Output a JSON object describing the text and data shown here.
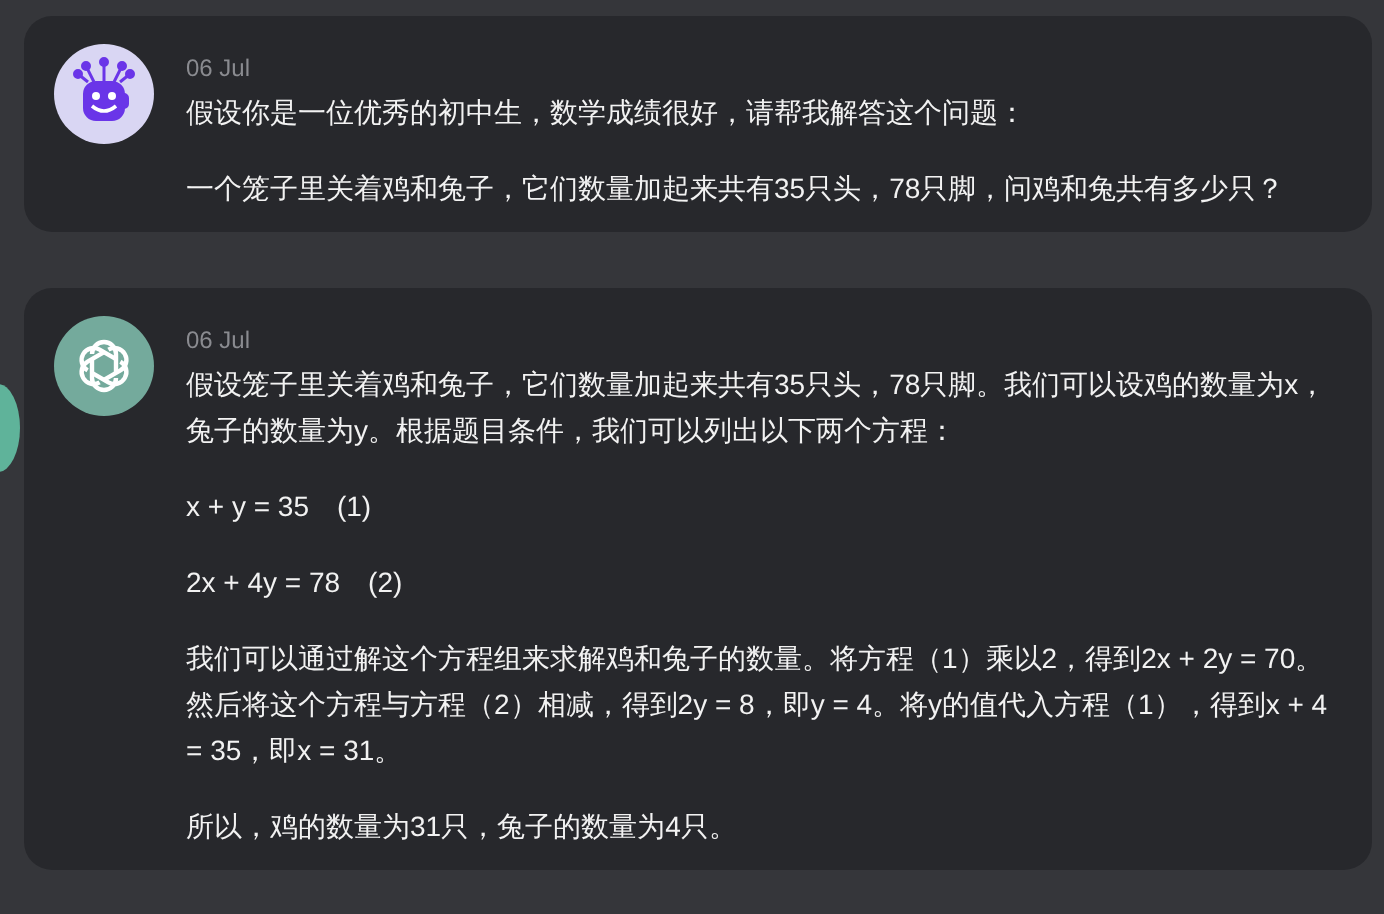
{
  "messages": [
    {
      "kind": "user",
      "date": "06 Jul",
      "paragraphs": [
        "假设你是一位优秀的初中生，数学成绩很好，请帮我解答这个问题：",
        "一个笼子里关着鸡和兔子，它们数量加起来共有35只头，78只脚，问鸡和兔共有多少只？"
      ]
    },
    {
      "kind": "assistant",
      "date": "06 Jul",
      "paragraphs": [
        "假设笼子里关着鸡和兔子，它们数量加起来共有35只头，78只脚。我们可以设鸡的数量为x，兔子的数量为y。根据题目条件，我们可以列出以下两个方程：",
        "x + y = 35　(1)",
        "2x + 4y = 78　(2)",
        "我们可以通过解这个方程组来求解鸡和兔子的数量。将方程（1）乘以2，得到2x + 2y = 70。然后将这个方程与方程（2）相减，得到2y = 8，即y = 4。将y的值代入方程（1），得到x + 4 = 35，即x = 31。",
        "所以，鸡的数量为31只，兔子的数量为4只。"
      ]
    }
  ]
}
